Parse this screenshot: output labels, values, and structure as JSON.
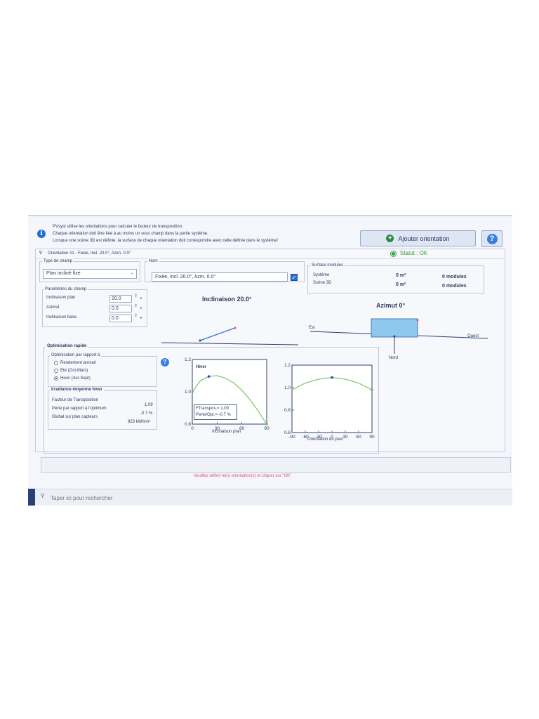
{
  "info": {
    "line1": "PVsyst utilise les orientations pour calculer le facteur de transposition.",
    "line2": "Chaque orientation doit être liée à au moins un sous champ dans la partie système.",
    "line3": "Lorsque une scène 3D est définie, la surface de chaque orientation doit correspondre avec celle définie dans le système!"
  },
  "toolbar": {
    "add_label": "Ajouter orientation",
    "help_label": "?"
  },
  "orientation": {
    "header": "Orientation #1 - Fixée, Incl. 20.0°, Azim. 0.0°",
    "status": "Statut : OK"
  },
  "field_type": {
    "legend": "Type de champ",
    "value": "Plan incliné fixe"
  },
  "name": {
    "legend": "Nom",
    "value": "Fixée, Incl. 20.0°, Azm. 0.0°"
  },
  "surface": {
    "legend": "Surface modules",
    "rows": [
      {
        "label": "Système",
        "area": "0 m²",
        "modules": "0 modules"
      },
      {
        "label": "Scène 3D",
        "area": "0 m²",
        "modules": "0 modules"
      }
    ]
  },
  "params": {
    "legend": "Paramètres du champ",
    "rows": [
      {
        "label": "Inclinaison plan",
        "value": "20.0"
      },
      {
        "label": "Azimut",
        "value": "0.0"
      },
      {
        "label": "Inclinaison base",
        "value": "0.0"
      }
    ]
  },
  "inclination_diagram": {
    "title": "Inclinaison 20.0°"
  },
  "azimuth_diagram": {
    "title": "Azimut 0°",
    "east": "Est",
    "west": "Ouest",
    "north": "Nord"
  },
  "quick_opt": {
    "title": "Optimisation rapide",
    "legend": "Optimisation par rapport à",
    "options": [
      "Rendement annuel",
      "Eté (Oct-Mars)",
      "Hiver (Avr-Sept)"
    ],
    "selected_index": 2
  },
  "irradiance": {
    "title": "Irradiance moyenne hiver",
    "rows": [
      {
        "label": "Facteur de Transposition",
        "value": "1.09"
      },
      {
        "label": "Perte par rapport à l'optimum",
        "value": "-0.7 %"
      },
      {
        "label": "Global sur plan capteurs",
        "value": "923 kWh/m²"
      }
    ]
  },
  "chart_data": [
    {
      "type": "line",
      "title": "Hiver",
      "xlabel": "Inclinaison plan",
      "xlim": [
        0,
        90
      ],
      "ylim": [
        0.8,
        1.2
      ],
      "xticks": [
        0,
        30,
        60,
        90
      ],
      "yticks": [
        "0.8",
        "1.0",
        "1.2"
      ],
      "x": [
        0,
        10,
        20,
        30,
        40,
        50,
        60,
        70,
        80,
        90
      ],
      "y": [
        1.0,
        1.07,
        1.095,
        1.1,
        1.085,
        1.055,
        1.01,
        0.95,
        0.88,
        0.8
      ],
      "current_point": {
        "x": 20,
        "y": 1.095
      },
      "annotations": [
        "FTranspos.= 1.09",
        "Perte/Opt.= -0.7 %"
      ]
    },
    {
      "type": "line",
      "xlabel": "Orientation du plan",
      "xlim": [
        -90,
        90
      ],
      "ylim": [
        0.6,
        1.2
      ],
      "xticks": [
        -90,
        -60,
        -30,
        0,
        30,
        60,
        90
      ],
      "yticks": [
        "0.6",
        "0.8",
        "1.0",
        "1.2"
      ],
      "x": [
        -90,
        -60,
        -30,
        0,
        30,
        60,
        90
      ],
      "y": [
        0.98,
        1.04,
        1.075,
        1.09,
        1.075,
        1.04,
        0.98
      ],
      "current_point": {
        "x": 0,
        "y": 1.09
      }
    }
  ],
  "footer": {
    "warning": "Veuillez définir le(s) orientation(s) et cliquer sur \"OK\"",
    "search_placeholder": "Taper ici pour rechercher"
  },
  "colors": {
    "accent": "#2a6fd6",
    "curve": "#7cc46a",
    "status_ok": "#3a9a3a",
    "warning": "#e0507a"
  }
}
